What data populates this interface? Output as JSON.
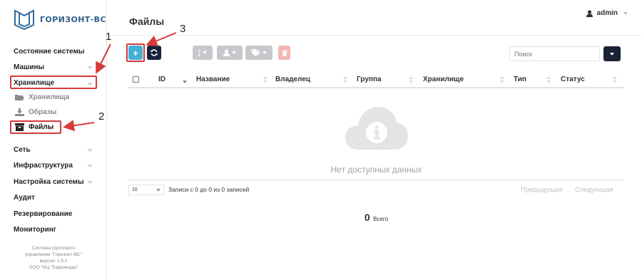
{
  "brand": {
    "name": "ГОРИЗОНТ-ВС"
  },
  "header": {
    "title": "Файлы",
    "user": "admin"
  },
  "sidebar": {
    "items": [
      {
        "label": "Состояние системы"
      },
      {
        "label": "Машины"
      },
      {
        "label": "Хранилище"
      },
      {
        "label": "Хранилища"
      },
      {
        "label": "Образы"
      },
      {
        "label": "Файлы"
      },
      {
        "label": "Сеть"
      },
      {
        "label": "Инфраструктура"
      },
      {
        "label": "Настройка системы"
      },
      {
        "label": "Аудит"
      },
      {
        "label": "Резервирование"
      },
      {
        "label": "Мониторинг"
      }
    ],
    "footer": {
      "line1": "Система группового",
      "line2": "управления \"Горизонт-ВС\"",
      "line3": "версия: 1.5.1",
      "line4": "ООО \"ИЦ \"Баррикады\""
    }
  },
  "toolbar": {
    "add_label": "+",
    "search_placeholder": "Поиск"
  },
  "table": {
    "columns": [
      "ID",
      "Название",
      "Владелец",
      "Группа",
      "Хранилище",
      "Тип",
      "Статус"
    ],
    "empty_text": "Нет доступных данных",
    "page_length": "10",
    "info": "Записи с 0 до 0 из 0 записей",
    "prev": "Предыдущая",
    "next": "Следующая",
    "total_count": "0",
    "total_label": "Всего"
  },
  "annotations": {
    "a1": "1",
    "a2": "2",
    "a3": "3"
  },
  "colors": {
    "accent": "#45b0d6",
    "dark": "#18233a",
    "highlight": "#d63a3a",
    "brand": "#2f5f8a"
  }
}
